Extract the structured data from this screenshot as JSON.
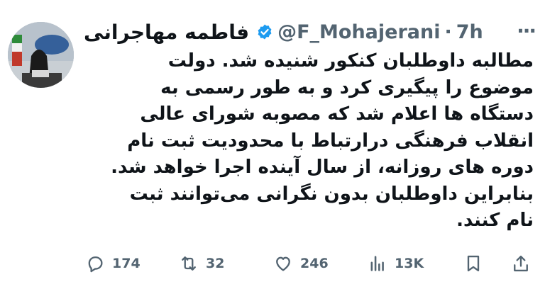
{
  "author": {
    "name": "فاطمه مهاجرانی",
    "handle": "@F_Mohajerani",
    "separator": "·",
    "time": "7h",
    "verified": true
  },
  "tweet": {
    "lines": [
      "مطالبه داوطلبان کنکور شنیده شد. دولت",
      "موضوع را پیگیری کرد و به طور رسمی به",
      "دستگاه ها اعلام شد که مصوبه شورای عالی",
      "انقلاب فرهنگی درارتباط با محدودیت ثبت نام",
      "دوره های روزانه، از سال آینده اجرا خواهد شد.",
      "بنابراین داوطلبان بدون نگرانی می‌توانند ثبت",
      "نام کنند."
    ]
  },
  "actions": {
    "replies": "174",
    "retweets": "32",
    "likes": "246",
    "views": "13K"
  },
  "icons": {
    "verified": "verified-badge-icon",
    "more": "more-icon",
    "reply": "reply-icon",
    "retweet": "retweet-icon",
    "like": "heart-icon",
    "views": "views-icon",
    "bookmark": "bookmark-icon",
    "share": "share-icon"
  },
  "colors": {
    "text": "#0f1419",
    "secondary": "#536471",
    "verified": "#1d9bf0"
  }
}
